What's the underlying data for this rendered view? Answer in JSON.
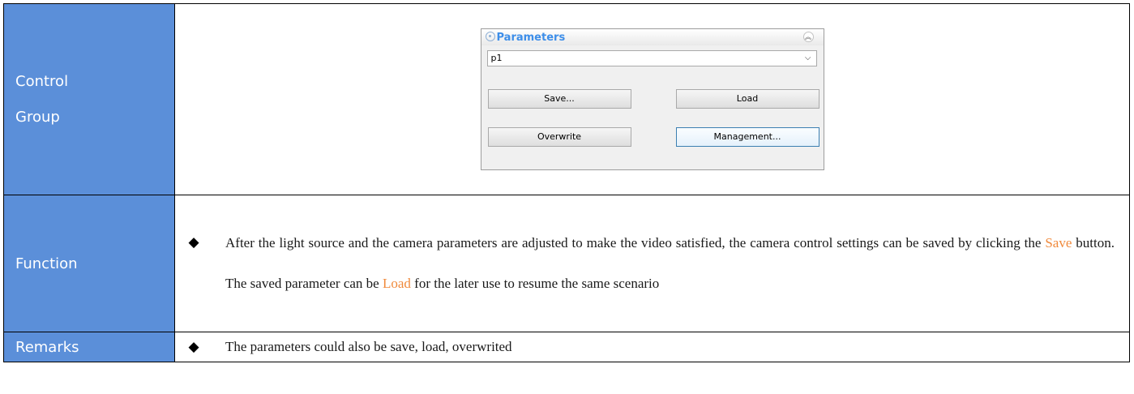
{
  "rows": {
    "control": {
      "label_line1": "Control",
      "label_line2": "Group"
    },
    "function": {
      "label": "Function"
    },
    "remarks": {
      "label": "Remarks"
    }
  },
  "panel": {
    "title": "Parameters",
    "dropdown_value": "p1",
    "buttons": {
      "save": "Save...",
      "load": "Load",
      "overwrite": "Overwrite",
      "management": "Management..."
    }
  },
  "function_text": {
    "part1": "After the light source and the camera parameters are adjusted to make the video satisfied, the camera control settings can be saved by clicking the ",
    "save_word": "Save",
    "part2": " button. The saved parameter can be ",
    "load_word": "Load",
    "part3": " for the later use to resume the same scenario"
  },
  "remarks_text": "The parameters could also be save, load, overwrited",
  "bullet_glyph": "◆",
  "colors": {
    "label_bg": "#5b8fd9",
    "highlight": "#f08a3c",
    "panel_title": "#3d8ee9"
  }
}
